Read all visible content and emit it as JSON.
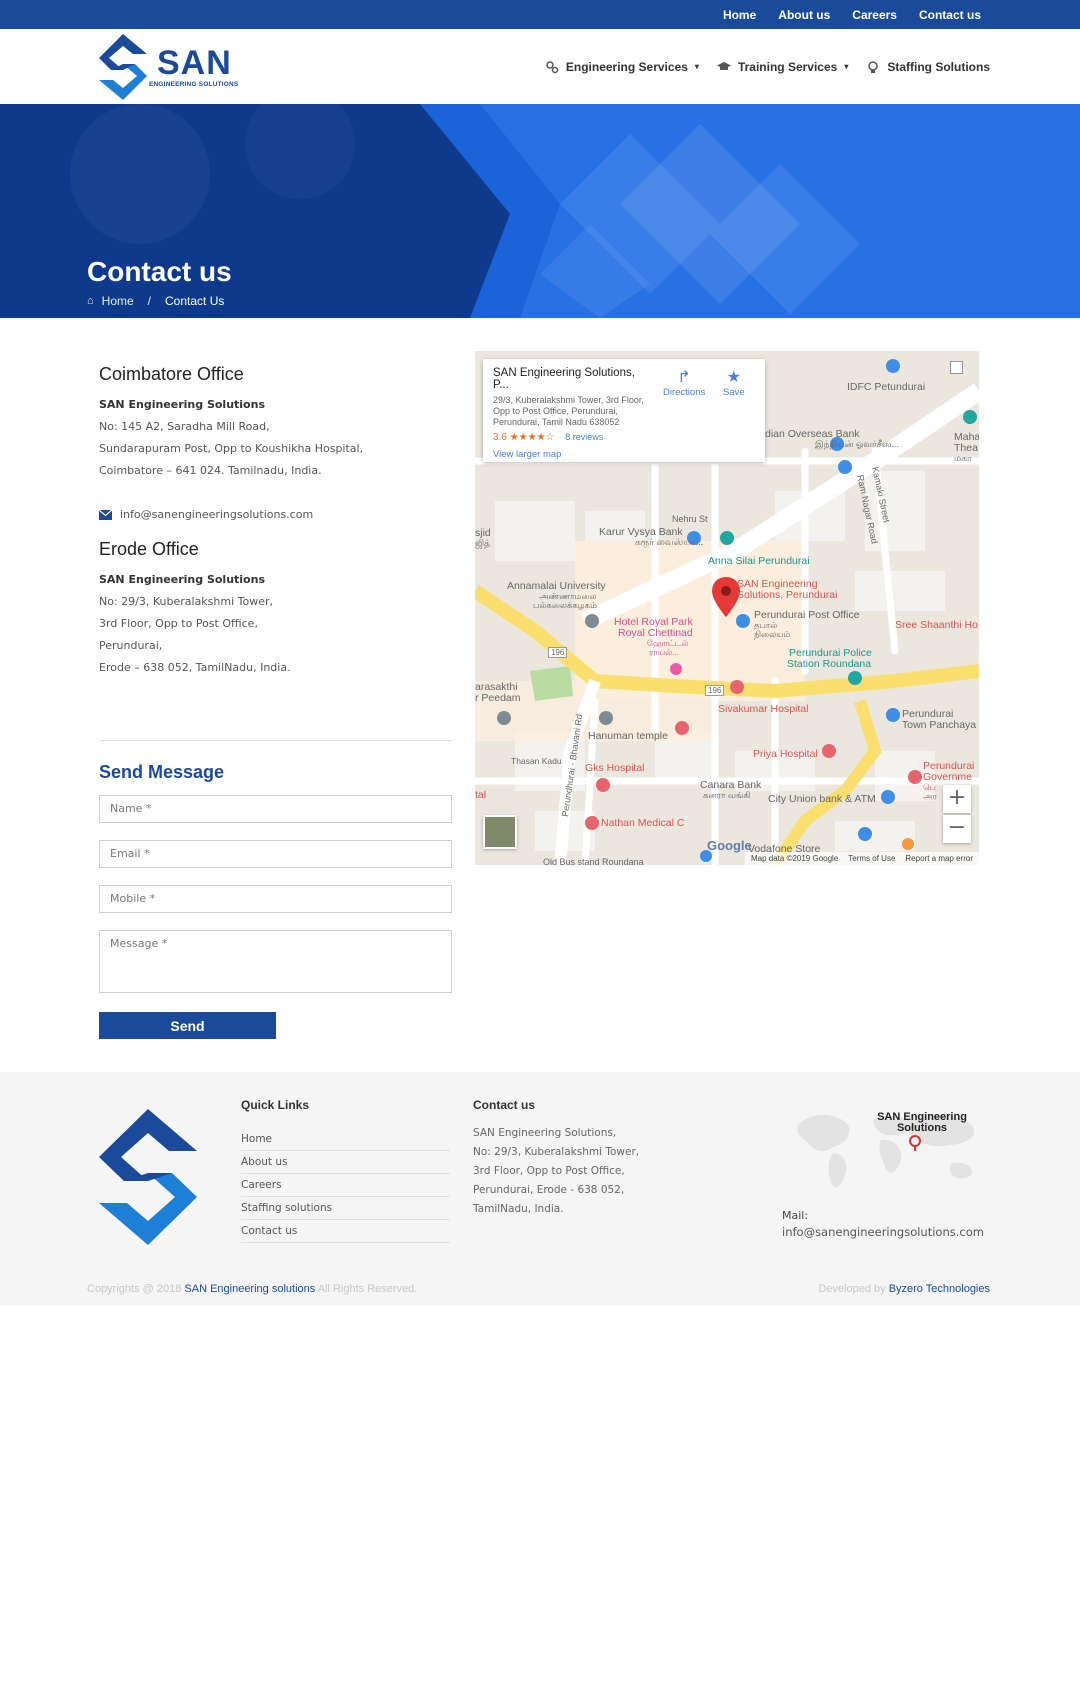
{
  "topbar": {
    "links": [
      "Home",
      "About us",
      "Careers",
      "Contact us"
    ]
  },
  "brand": {
    "name": "SAN",
    "tagline": "ENGINEERING SOLUTIONS",
    "primary_color": "#1b4a9b",
    "accent_color": "#1e7fd6"
  },
  "nav": {
    "engineering": "Engineering Services",
    "training": "Training Services",
    "staffing": "Staffing Solutions"
  },
  "hero": {
    "title": "Contact us",
    "crumb_home": "Home",
    "crumb_sep": "/",
    "crumb_current": "Contact Us"
  },
  "coimbatore": {
    "heading": "Coimbatore Office",
    "company": "SAN Engineering Solutions",
    "lines": [
      "No: 145 A2, Saradha Mill Road,",
      "Sundarapuram Post, Opp to Koushikha Hospital,",
      "Coimbatore  – 641 024. Tamilnadu, India."
    ],
    "email": "info@sanengineeringsolutions.com"
  },
  "erode": {
    "heading": "Erode Office",
    "company": "SAN Engineering Solutions",
    "lines": [
      "No: 29/3, Kuberalakshmi Tower,",
      "3rd Floor, Opp to Post Office,",
      "Perundurai,",
      "Erode – 638 052, TamilNadu, India."
    ]
  },
  "form": {
    "title": "Send Message",
    "name_placeholder": "Name *",
    "email_placeholder": "Email *",
    "mobile_placeholder": "Mobile *",
    "message_placeholder": "Message *",
    "send_label": "Send"
  },
  "map": {
    "card_title": "SAN Engineering Solutions, P...",
    "card_address": "29/3, Kuberalakshmi Tower, 3rd Floor, Opp to Post Office, Perundurai, Perundurai, Tamil Nadu 638052",
    "rating": "3.6",
    "stars": "★★★★☆",
    "reviews": "8 reviews",
    "larger": "View larger map",
    "directions": "Directions",
    "save": "Save",
    "pin_label_1": "SAN Engineering",
    "pin_label_2": "Solutions, Perundurai",
    "places": {
      "idfc": "IDFC Petundurai",
      "overseas": "dian Overseas Bank",
      "overseas_ta": "இந்தியன் ஓவர்சீஸ...",
      "maha": "Maha",
      "thea": "Thea",
      "maha_ta": "மகா",
      "kamaki": "Kamaki Street",
      "ramnagar": "Ram Nagar Road",
      "nehru": "Nehru St",
      "karur": "Karur Vysya Bank",
      "karur_ta": "கரூர் வைஸ்யா...",
      "anna": "Anna Silai Perundurai",
      "sjid": "sjid",
      "sjid_ta": "ஜித்",
      "annamalai": "Annamalai University",
      "annamalai_ta": "அண்ணாமலை",
      "annamalai_ta2": "பல்கலைக்கழகம்",
      "hotel": "Hotel Royal Park",
      "royal": "Royal Chettinad",
      "hotel_ta": "ஹோட்டல்",
      "hotel_ta2": "ராயல்...",
      "post": "Perundurai Post Office",
      "post_ta": "தபால்",
      "post_ta2": "நிலையம்",
      "shaanthi": "Sree Shaanthi Ho",
      "police": "Perundurai Police",
      "roundana": "Station Roundana",
      "road196a": "196",
      "road196b": "196",
      "arasakthi": "arasakthi",
      "peedam": "r Peedam",
      "bhavani": "Perundhurai - Bhavani Rd",
      "sivakumar": "Sivakumar Hospital",
      "panchayat": "Perundurai",
      "panchayat2": "Town Panchaya",
      "hanuman": "Hanuman temple",
      "thasan": "Thasan Kadu",
      "priya": "Priya Hospital",
      "gks": "Gks Hospital",
      "canara": "Canara Bank",
      "canara_ta": "கனரா வங்கி",
      "cityunion": "City Union bank & ATM",
      "govt": "Perundurai",
      "govt2": "Governme",
      "govt_ta": "பெ",
      "govt_ta2": "அர",
      "tal": "tal",
      "nathan": "Nathan Medical C",
      "vodafone": "Vodafone Store",
      "oldbus": "Old Bus stand Roundana"
    },
    "google": "Google",
    "footer_data": "Map data ©2019 Google",
    "footer_terms": "Terms of Use",
    "footer_report": "Report a map error",
    "zoom_in": "+",
    "zoom_out": "−"
  },
  "footer": {
    "quick_title": "Quick Links",
    "quick_links": [
      "Home",
      "About us",
      "Careers",
      "Staffing solutions",
      "Contact us"
    ],
    "contact_title": "Contact us",
    "contact_lines": [
      "SAN Engineering Solutions,",
      "No: 29/3, Kuberalakshmi Tower,",
      "3rd Floor, Opp to Post Office,",
      "Perundurai, Erode - 638 052,",
      "TamilNadu, India."
    ],
    "map_label_1": "SAN Engineering",
    "map_label_2": "Solutions",
    "mail_label": "Mail:",
    "mail": "info@sanengineeringsolutions.com",
    "copyright_prefix": "Copyrights @ 2018",
    "copyright_brand": "SAN Engineering solutions",
    "copyright_suffix": "All Rights Reserved.",
    "dev_prefix": "Developed by",
    "dev_brand": "Byzero Technologies"
  }
}
